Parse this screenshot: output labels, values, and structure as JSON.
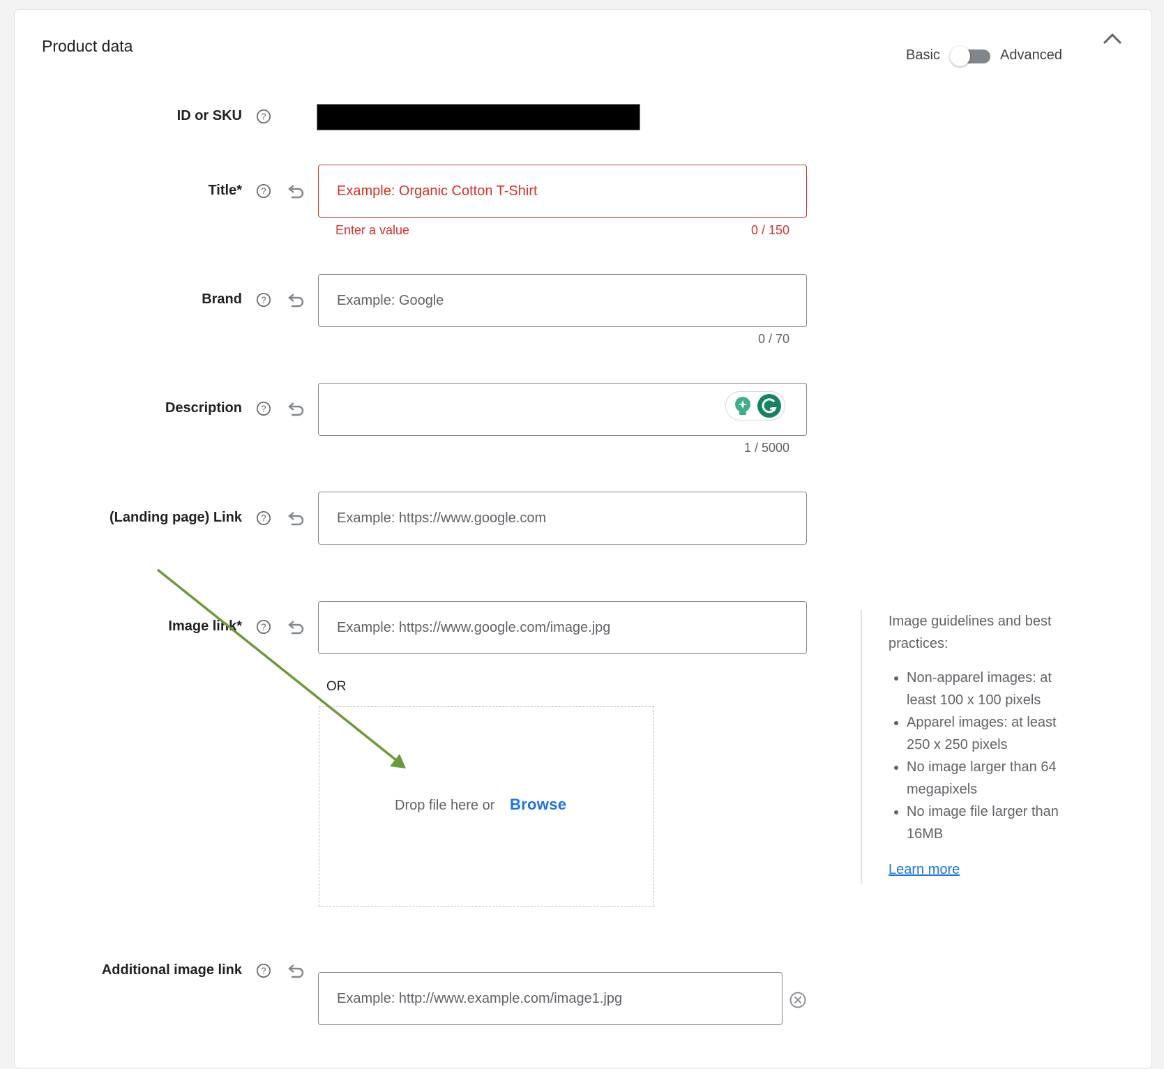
{
  "card": {
    "title": "Product data",
    "mode_toggle": {
      "left_label": "Basic",
      "right_label": "Advanced",
      "advanced_enabled": false
    },
    "collapse_icon": "chevron-up-icon"
  },
  "fields": {
    "id_sku": {
      "label": "ID or SKU",
      "value_redacted": true
    },
    "title": {
      "label": "Title*",
      "placeholder": "Example: Organic Cotton T-Shirt",
      "value": "",
      "error": "Enter a value",
      "counter": "0 / 150"
    },
    "brand": {
      "label": "Brand",
      "placeholder": "Example: Google",
      "value": "",
      "counter": "0 / 70"
    },
    "description": {
      "label": "Description",
      "placeholder": "",
      "value": "",
      "counter": "1 / 5000"
    },
    "link": {
      "label": "(Landing page) Link",
      "placeholder": "Example: https://www.google.com",
      "value": ""
    },
    "image_link": {
      "label": "Image link*",
      "placeholder": "Example: https://www.google.com/image.jpg",
      "value": ""
    },
    "additional_image_link": {
      "label": "Additional image link",
      "placeholder": "Example: http://www.example.com/image1.jpg",
      "value": ""
    }
  },
  "upload": {
    "or_label": "OR",
    "drop_text": "Drop file here or",
    "browse_label": "Browse"
  },
  "guidelines": {
    "heading": "Image guidelines and best practices:",
    "items": [
      "Non-apparel images: at least 100 x 100 pixels",
      "Apparel images: at least 250 x 250 pixels",
      "No image larger than 64 megapixels",
      "No image file larger than 16MB"
    ],
    "learn_more": "Learn more"
  },
  "colors": {
    "error": "#d93025",
    "link": "#1a73e8",
    "annotation_arrow": "#6a9a3a",
    "grammarly": "#15835f"
  }
}
